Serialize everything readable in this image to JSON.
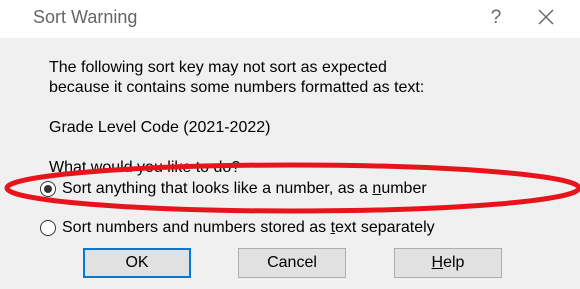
{
  "dialog": {
    "title": "Sort Warning",
    "help_glyph": "?",
    "close_icon": "close-icon"
  },
  "message": {
    "line1": "The following sort key may not sort as expected",
    "line2": "because it contains some numbers formatted as text:",
    "sort_key": "Grade Level Code (2021-2022)",
    "question": "What would you like to do?"
  },
  "options": [
    {
      "label_before": "Sort anything that looks like a number, as a ",
      "label_ul": "n",
      "label_after": "umber",
      "checked": true
    },
    {
      "label_before": "Sort numbers and numbers stored as ",
      "label_ul": "t",
      "label_after": "ext separately",
      "checked": false
    }
  ],
  "buttons": {
    "ok": "OK",
    "cancel": "Cancel",
    "help_ul": "H",
    "help_rest": "elp"
  },
  "colors": {
    "annotation": "#e8141c",
    "default_button_border": "#0078d7"
  }
}
